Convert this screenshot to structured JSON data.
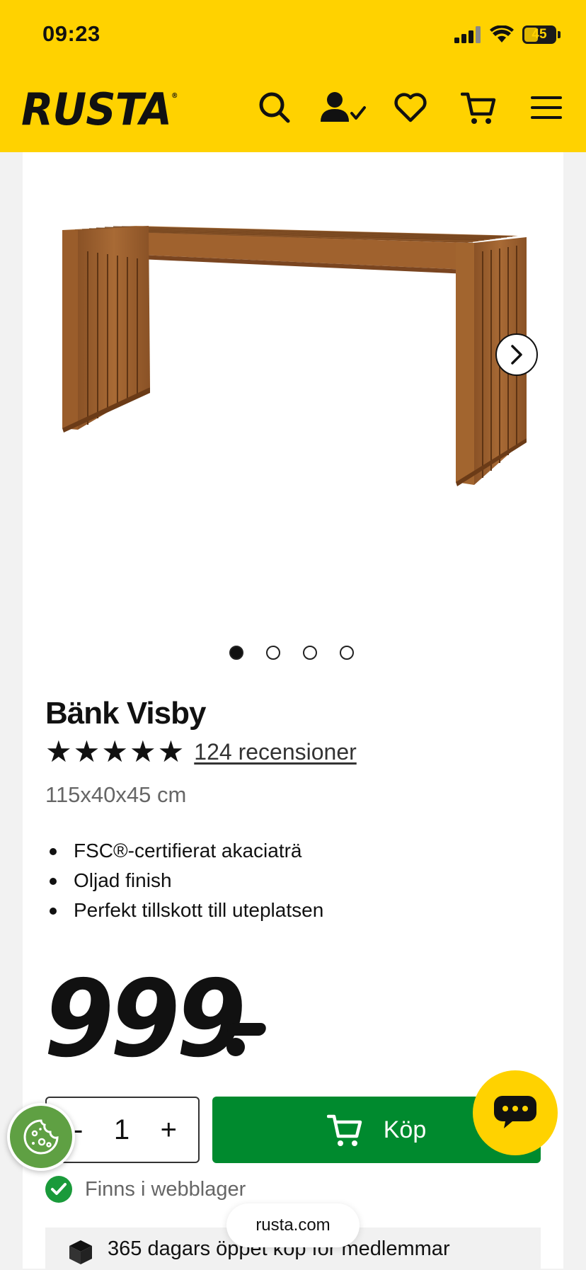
{
  "status_bar": {
    "time": "09:23",
    "battery": "45",
    "battery_level": 0.45
  },
  "header": {
    "logo": "RUSTA",
    "icons": [
      "search-icon",
      "account-icon",
      "heart-icon",
      "cart-icon",
      "menu-icon"
    ]
  },
  "gallery": {
    "image_count": 4,
    "active_index": 0
  },
  "product": {
    "title": "Bänk Visby",
    "rating": 5,
    "reviews": "124 recensioner",
    "dimensions": "115x40x45 cm",
    "features": [
      "FSC®-certifierat akaciaträ",
      "Oljad finish",
      "Perfekt tillskott till uteplatsen"
    ],
    "price": "999"
  },
  "purchase": {
    "qty_minus": "-",
    "quantity": "1",
    "qty_plus": "+",
    "buy_label": "Köp",
    "stock": "Finns i webblager"
  },
  "promo": {
    "text": "365 dagars öppet köp för medlemmar"
  },
  "browser": {
    "url": "rusta.com"
  },
  "colors": {
    "brand_yellow": "#ffd200",
    "buy_green": "#008a2e",
    "stock_green": "#1a9a3a",
    "cookie_green": "#5fa043"
  }
}
